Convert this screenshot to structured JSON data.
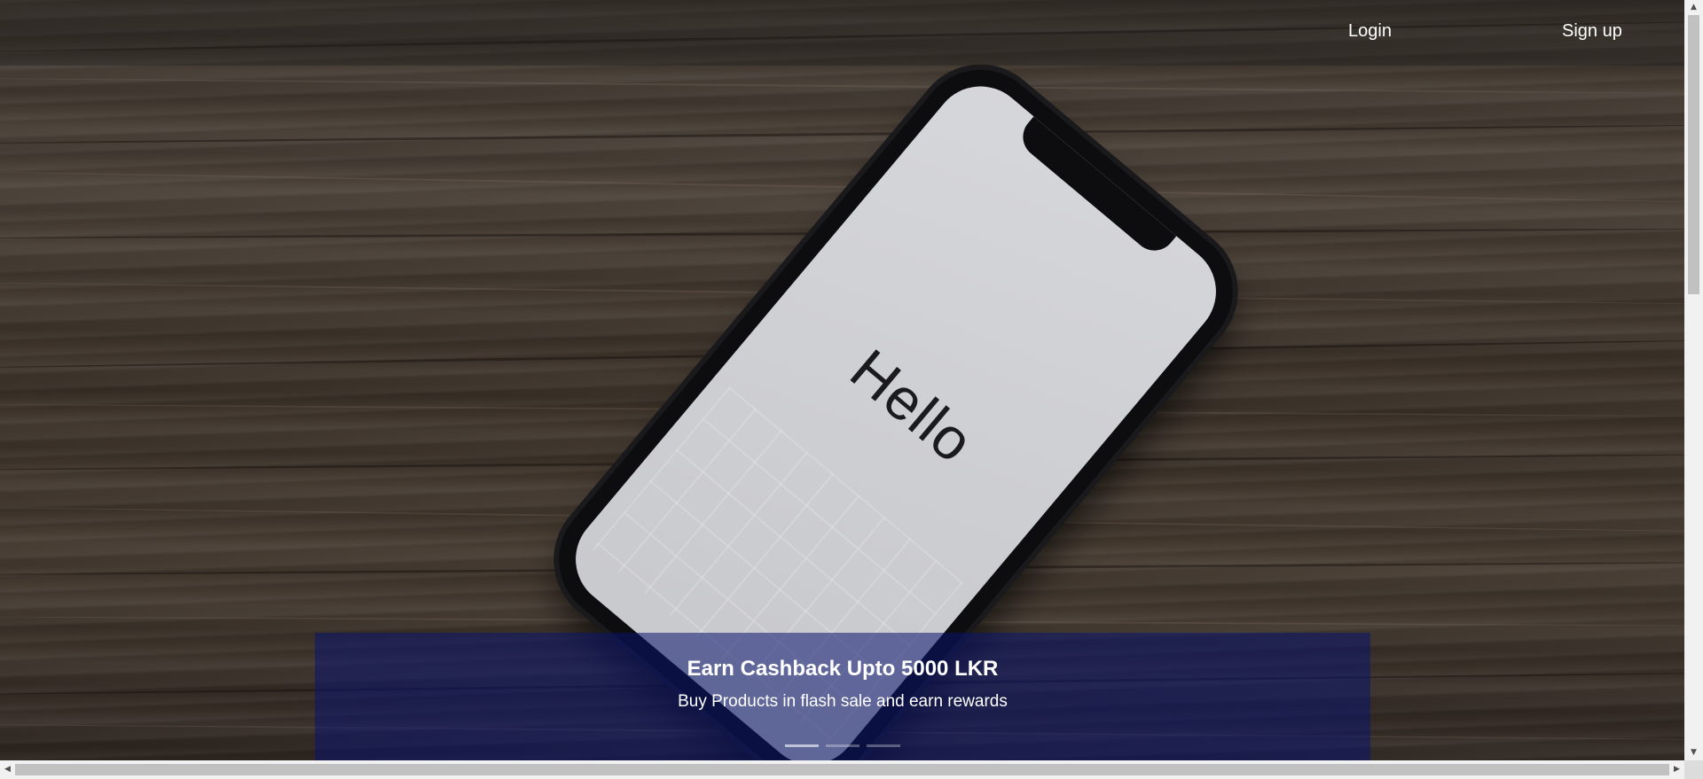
{
  "nav": {
    "login_label": "Login",
    "signup_label": "Sign up"
  },
  "hero": {
    "phone_screen_text": "Hello",
    "caption": {
      "title": "Earn Cashback Upto 5000 LKR",
      "subtitle": "Buy Products in flash sale and earn rewards"
    },
    "carousel": {
      "slide_count": 3,
      "active_index": 0
    }
  },
  "colors": {
    "caption_background": "#0a146e",
    "nav_text": "#ffffff",
    "wood_background": "#3d342c"
  },
  "scrollbars": {
    "vertical_arrow_up": "▲",
    "vertical_arrow_down": "▼",
    "horizontal_arrow_left": "◀",
    "horizontal_arrow_right": "▶"
  }
}
